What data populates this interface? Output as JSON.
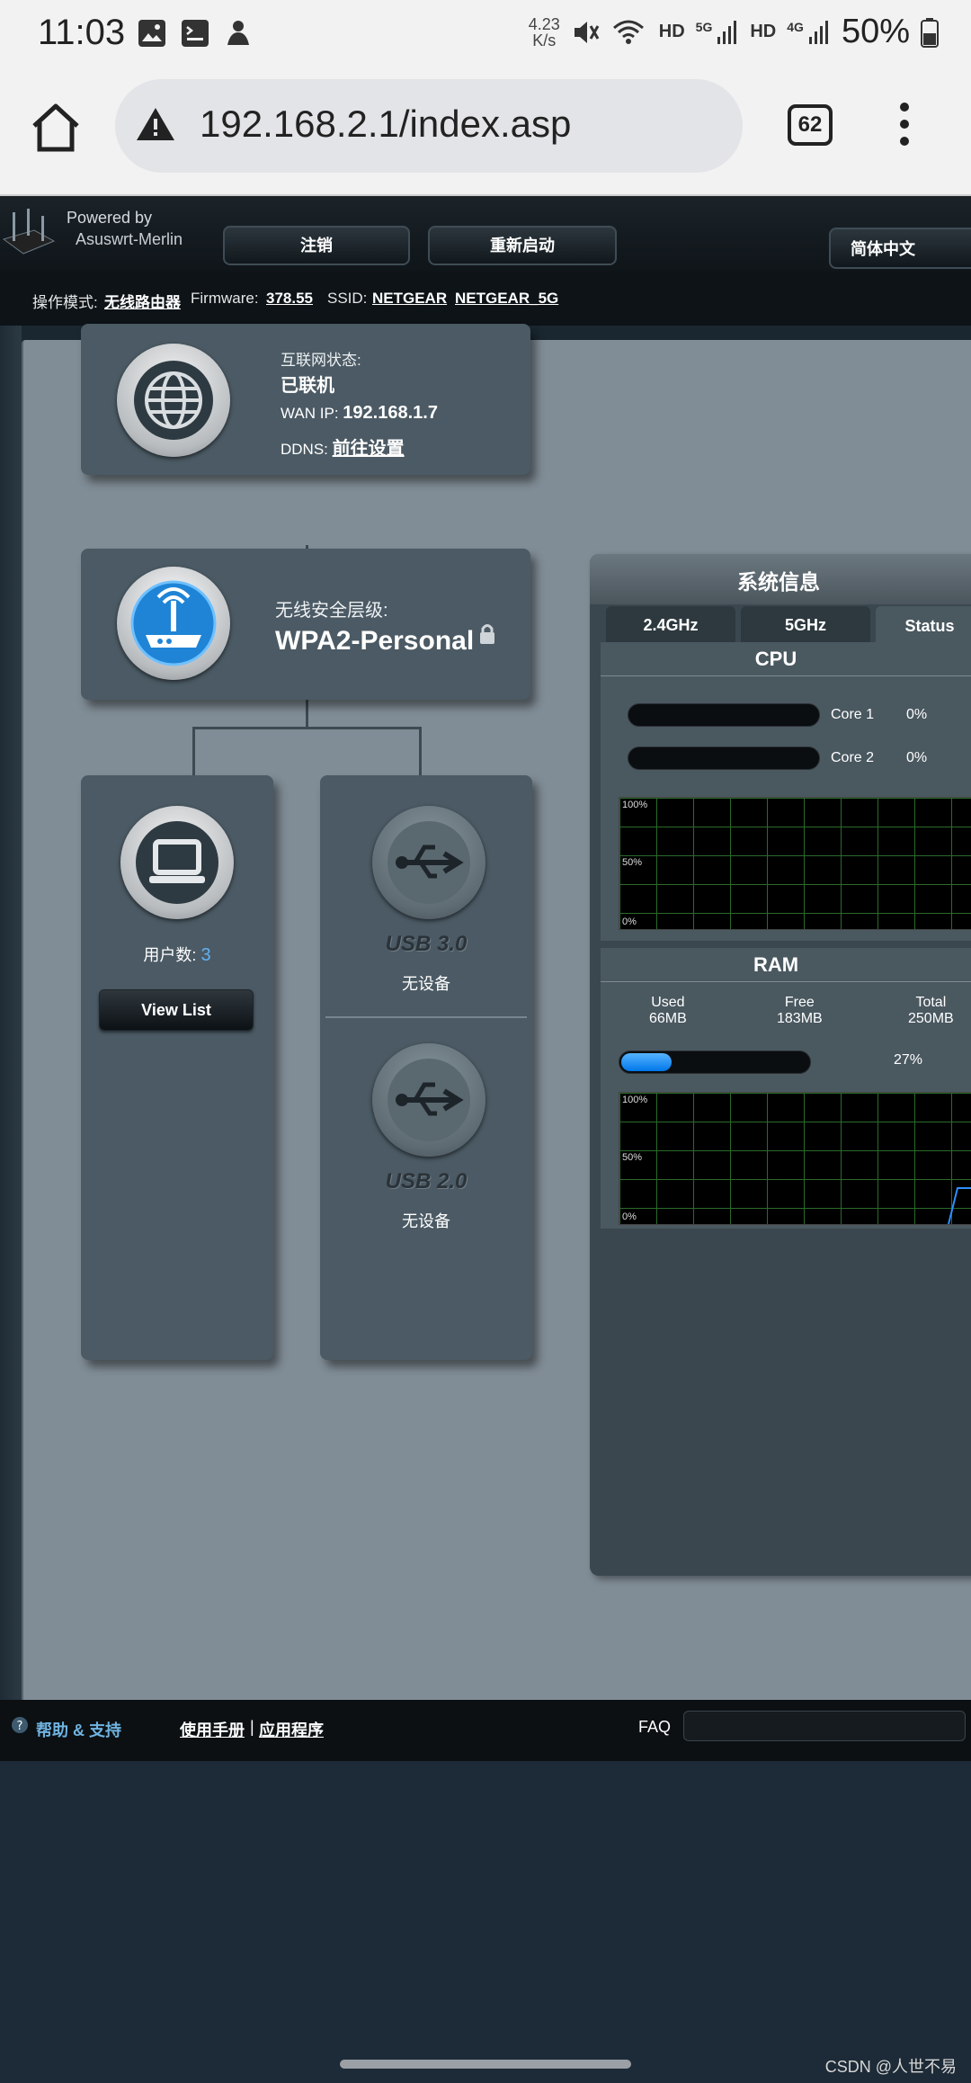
{
  "status_bar": {
    "time": "11:03",
    "speed_value": "4.23",
    "speed_unit": "K/s",
    "hd1": "HD",
    "net1": "5G",
    "hd2": "HD",
    "net2": "4G",
    "battery": "50%",
    "icons": [
      "image-icon",
      "terminal-icon",
      "app-icon",
      "mute-icon",
      "wifi-icon",
      "signal-icon",
      "battery-icon"
    ]
  },
  "browser": {
    "url": "192.168.2.1/index.asp",
    "tab_count": "62"
  },
  "router": {
    "logo": {
      "powered": "Powered by",
      "brand": "Asuswrt-Merlin"
    },
    "nav": {
      "logout": "注销",
      "reboot": "重新启动",
      "language": "简体中文"
    },
    "info": {
      "mode_label": "操作模式:",
      "mode_value": "无线路由器",
      "fw_label": "Firmware:",
      "fw_value": "378.55",
      "ssid_label": "SSID:",
      "ssid1": "NETGEAR",
      "ssid2": "NETGEAR_5G"
    },
    "internet": {
      "status_label": "互联网状态:",
      "status_value": "已联机",
      "wan_label": "WAN IP:",
      "wan_value": "192.168.1.7",
      "ddns_label": "DDNS:",
      "ddns_value": "前往设置"
    },
    "wireless": {
      "label": "无线安全层级:",
      "value": "WPA2-Personal"
    },
    "clients": {
      "label": "用户数:",
      "count": "3",
      "button": "View List"
    },
    "usb": [
      {
        "name": "USB 3.0",
        "status": "无设备"
      },
      {
        "name": "USB 2.0",
        "status": "无设备"
      }
    ],
    "sysinfo": {
      "title": "系统信息",
      "tabs": [
        "2.4GHz",
        "5GHz",
        "Status"
      ],
      "cpu": {
        "title": "CPU",
        "cores": [
          {
            "name": "Core 1",
            "value": "0%",
            "fraction": 0
          },
          {
            "name": "Core 2",
            "value": "0%",
            "fraction": 0
          }
        ],
        "graph_labels": [
          "100%",
          "50%",
          "0%"
        ]
      },
      "ram": {
        "title": "RAM",
        "used_label": "Used",
        "used_value": "66MB",
        "free_label": "Free",
        "free_value": "183MB",
        "total_label": "Total",
        "total_value": "250MB",
        "percent": "27%",
        "fraction": 0.27,
        "graph_labels": [
          "100%",
          "50%",
          "0%"
        ]
      }
    },
    "footer": {
      "help": "帮助 & 支持",
      "manual": "使用手册",
      "separator": "|",
      "utility": "应用程序",
      "faq": "FAQ"
    }
  },
  "watermark": "CSDN @人世不易"
}
